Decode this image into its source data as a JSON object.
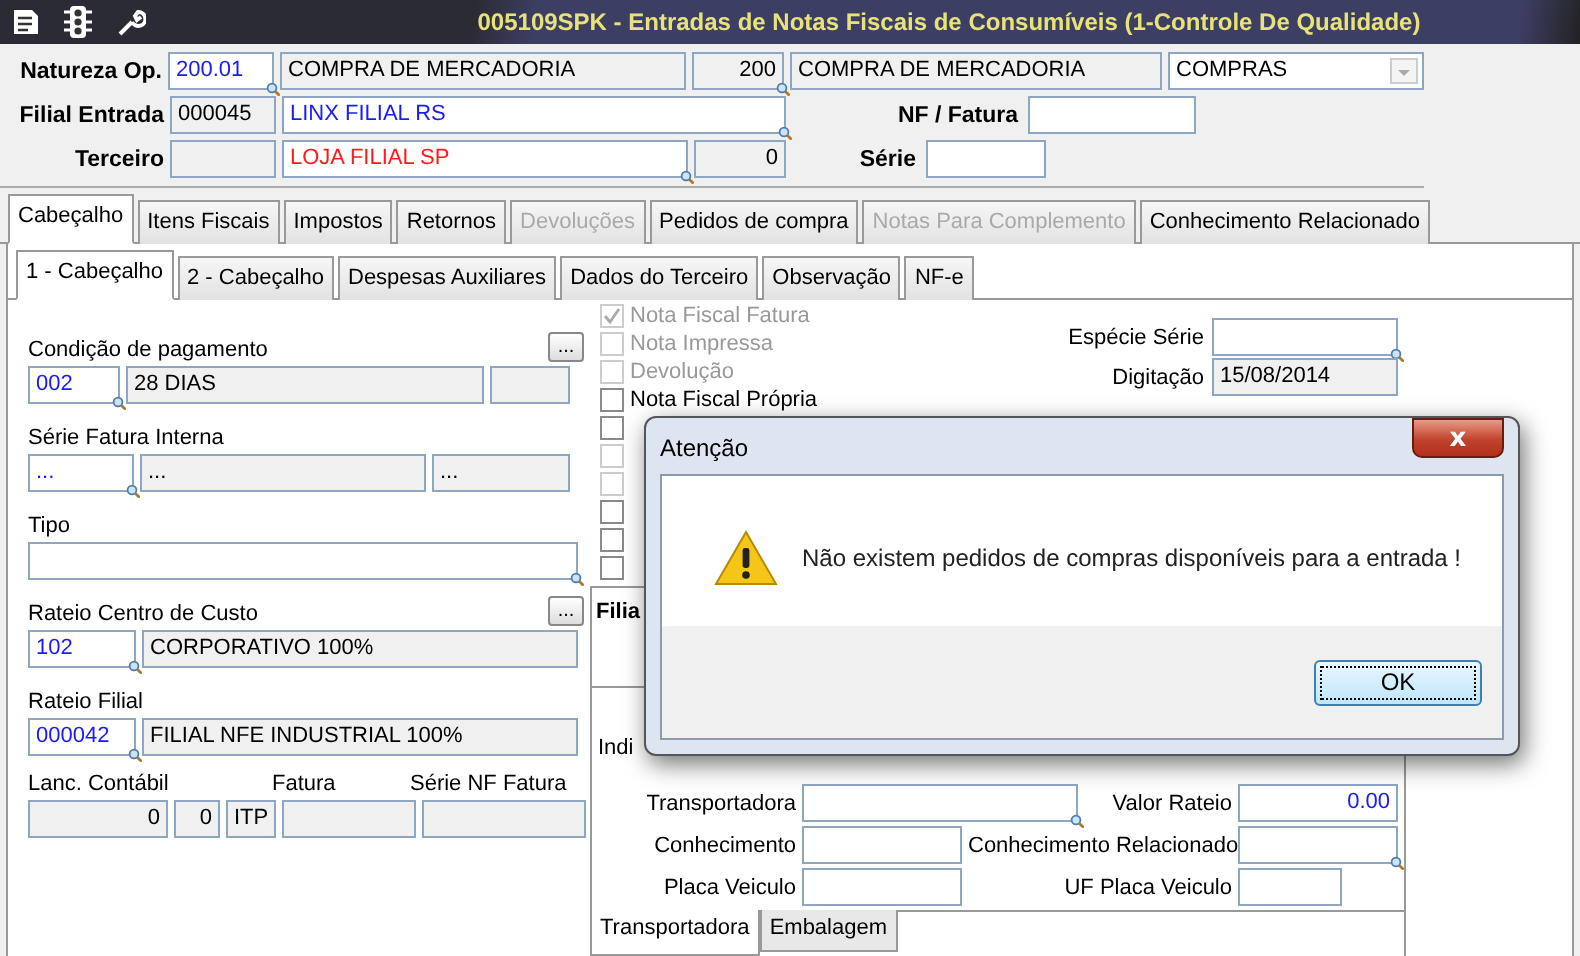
{
  "window": {
    "title": "005109SPK - Entradas de Notas Fiscais de Consumíveis (1-Controle De Qualidade)"
  },
  "header": {
    "rows": [
      {
        "label": "Natureza Op.",
        "fields": [
          {
            "value": "200.01",
            "lookup": true,
            "readonly": false
          },
          {
            "value": "COMPRA DE MERCADORIA",
            "readonly": true
          },
          {
            "value": "200",
            "lookup": true,
            "readonly": true
          },
          {
            "value": "COMPRA DE MERCADORIA",
            "readonly": true
          },
          {
            "value": "COMPRAS",
            "kind": "dropdown",
            "readonly": false
          }
        ]
      },
      {
        "label": "Filial Entrada",
        "fields": [
          {
            "value": "000045",
            "readonly": true
          },
          {
            "value": "LINX FILIAL RS",
            "lookup": true,
            "readonly": false
          }
        ],
        "side_label": "NF / Fatura"
      },
      {
        "label": "Terceiro",
        "fields": [
          {
            "readonly": true
          },
          {
            "value": "LOJA FILIAL SP",
            "lookup": true,
            "readonly": false
          },
          {
            "value": "0",
            "readonly": true
          }
        ],
        "side_label": "Série"
      }
    ]
  },
  "tabs": [
    {
      "label": "Cabeçalho",
      "selected": true,
      "disabled": false
    },
    {
      "label": "Itens Fiscais",
      "selected": false,
      "disabled": false
    },
    {
      "label": "Impostos",
      "selected": false,
      "disabled": false
    },
    {
      "label": "Retornos",
      "selected": false,
      "disabled": false
    },
    {
      "label": "Devoluções",
      "selected": false,
      "disabled": true
    },
    {
      "label": "Pedidos de compra",
      "selected": false,
      "disabled": false
    },
    {
      "label": "Notas Para Complemento",
      "selected": false,
      "disabled": true
    },
    {
      "label": "Conhecimento Relacionado",
      "selected": false,
      "disabled": false
    }
  ],
  "subtabs": [
    {
      "label": "1 - Cabeçalho",
      "selected": true
    },
    {
      "label": "2 - Cabeçalho",
      "selected": false
    },
    {
      "label": "Despesas Auxiliares",
      "selected": false
    },
    {
      "label": "Dados do Terceiro",
      "selected": false
    },
    {
      "label": "Observação",
      "selected": false
    },
    {
      "label": "NF-e",
      "selected": false
    }
  ],
  "left": {
    "groups": [
      {
        "label": "Condição de pagamento",
        "more": "...",
        "fields": [
          {
            "value": "002",
            "lookup": true,
            "readonly": false
          },
          {
            "value": "28 DIAS",
            "readonly": true
          },
          {
            "readonly": true
          }
        ]
      },
      {
        "label": "Série Fatura Interna",
        "fields": [
          {
            "value": "...",
            "lookup": true,
            "readonly": false
          },
          {
            "value": "...",
            "readonly": true
          },
          {
            "value": "...",
            "readonly": true
          }
        ]
      },
      {
        "label": "Tipo",
        "fields": [
          {
            "lookup": true,
            "readonly": false
          }
        ]
      },
      {
        "label": "Rateio Centro de Custo",
        "more": "...",
        "fields": [
          {
            "value": "102",
            "lookup": true,
            "readonly": false
          },
          {
            "value": "CORPORATIVO 100%",
            "readonly": true
          }
        ]
      },
      {
        "label": "Rateio Filial",
        "fields": [
          {
            "value": "000042",
            "lookup": true,
            "readonly": false
          },
          {
            "value": "FILIAL NFE INDUSTRIAL 100%",
            "readonly": true
          }
        ]
      }
    ],
    "totals": {
      "labels": [
        "Lanc. Contábil",
        "Fatura",
        "Série NF Fatura"
      ],
      "fields": [
        {
          "value": "0",
          "readonly": true
        },
        {
          "value": "0",
          "readonly": true
        },
        {
          "value": "ITP",
          "readonly": true
        },
        {
          "readonly": true
        },
        {
          "readonly": true
        }
      ]
    }
  },
  "checks": [
    {
      "label": "Nota Fiscal Fatura",
      "checked": true,
      "disabled": true
    },
    {
      "label": "Nota Impressa",
      "checked": false,
      "disabled": true
    },
    {
      "label": "Devolução",
      "checked": false,
      "disabled": true
    },
    {
      "label": "Nota Fiscal Própria",
      "checked": false,
      "disabled": false
    },
    {
      "checked": false,
      "disabled": false
    },
    {
      "checked": false,
      "disabled": true
    },
    {
      "checked": false,
      "disabled": true
    },
    {
      "checked": false,
      "disabled": false
    },
    {
      "checked": false,
      "disabled": false
    },
    {
      "checked": false,
      "disabled": false
    }
  ],
  "right_fields": [
    {
      "label": "Espécie Série",
      "lookup": true,
      "readonly": false
    },
    {
      "label": "Digitação",
      "value": "15/08/2014",
      "readonly": true
    }
  ],
  "transport": {
    "filial_label": "Filia",
    "indicator_label": "Indi",
    "rows": [
      [
        {
          "label": "Transportadora",
          "lookup": true,
          "readonly": false
        },
        {
          "label": "Valor Rateio",
          "value": "0.00",
          "readonly": false
        }
      ],
      [
        {
          "label": "Conhecimento",
          "readonly": false
        },
        {
          "label": "Conhecimento Relacionado",
          "lookup": true,
          "readonly": false
        }
      ],
      [
        {
          "label": "Placa Veiculo",
          "readonly": false
        },
        {
          "label": "UF Placa Veiculo",
          "readonly": false
        }
      ]
    ],
    "tabs": [
      {
        "label": "Transportadora",
        "selected": true
      },
      {
        "label": "Embalagem",
        "selected": false
      }
    ]
  },
  "dialog": {
    "title": "Atenção",
    "close": "x",
    "message": "Não existem pedidos de compras disponíveis para a entrada !",
    "button": "OK"
  }
}
